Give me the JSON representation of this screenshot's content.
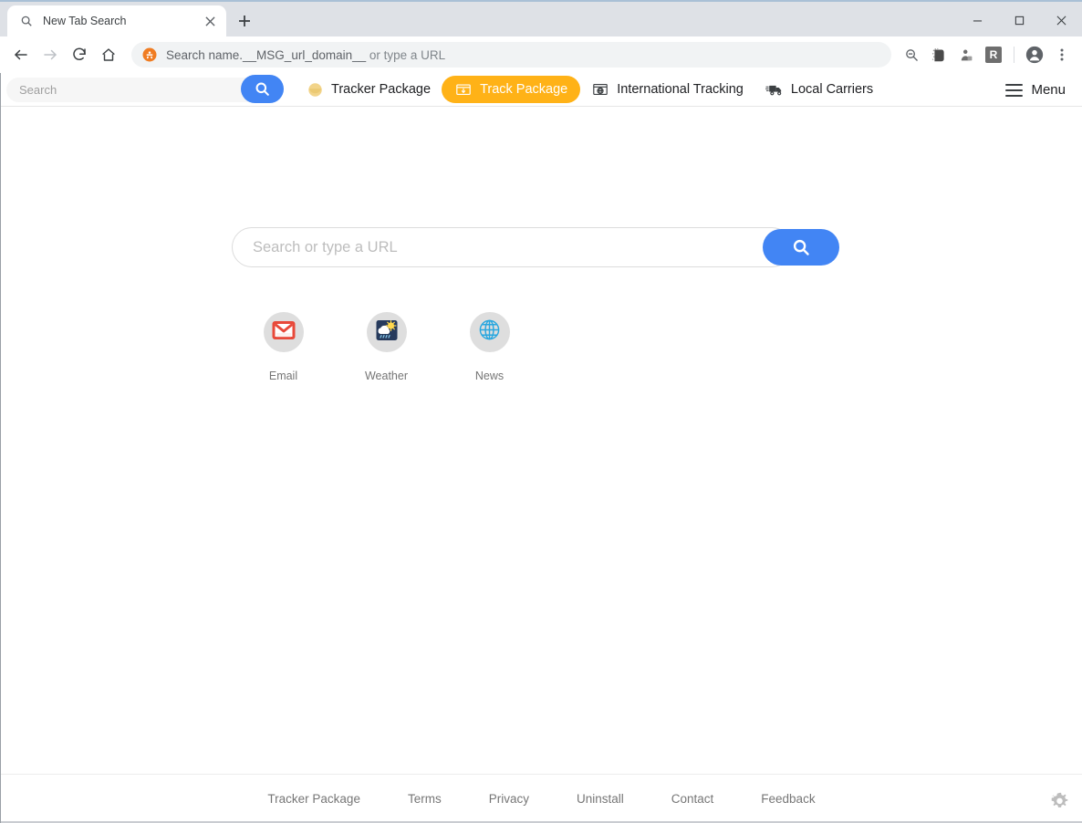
{
  "browser": {
    "tab": {
      "title": "New Tab Search",
      "favicon_name": "search-icon",
      "close_label": "×"
    },
    "new_tab_button_label": "+",
    "window_controls": {
      "minimize": "—",
      "maximize": "□",
      "close": "✕"
    },
    "nav": {
      "back_label": "←",
      "forward_label": "→",
      "reload_label": "↻",
      "home_label": "⌂"
    },
    "omnibox": {
      "text": "Search name.__MSG_url_domain__ or type a URL",
      "query_part": "Search name.__MSG_url_domain__",
      "hint_part": " or type a URL",
      "favicon_name": "extension-favicon-orange"
    },
    "toolbar_icons": [
      {
        "name": "zoom-out-icon",
        "glyph": "zoom"
      },
      {
        "name": "extension-icon-dark",
        "glyph": "ext"
      },
      {
        "name": "extension-icon-small",
        "glyph": "ext2"
      },
      {
        "name": "extension-badge-r",
        "label": "R"
      }
    ],
    "profile_name": "profile-avatar",
    "menu_name": "browser-menu-icon"
  },
  "ext_nav": {
    "search": {
      "value": "",
      "placeholder": "Search",
      "button_name": "nav-search-button",
      "button_color": "#4285f4"
    },
    "items": [
      {
        "label": "Tracker Package",
        "icon": "package-circle-icon",
        "active": false
      },
      {
        "label": "Track Package",
        "icon": "package-box-icon",
        "active": true
      },
      {
        "label": "International Tracking",
        "icon": "international-package-icon",
        "active": false
      },
      {
        "label": "Local Carriers",
        "icon": "delivery-truck-icon",
        "active": false
      }
    ],
    "active_pill_color": "#ffb217",
    "menu": {
      "label": "Menu",
      "icon": "hamburger-menu-icon"
    }
  },
  "hero": {
    "search": {
      "value": "",
      "placeholder": "Search or type a URL",
      "button_name": "hero-search-button",
      "button_color": "#4285f4"
    }
  },
  "shortcuts": [
    {
      "label": "Email",
      "icon": "gmail-envelope-icon",
      "color": "#e8493a"
    },
    {
      "label": "Weather",
      "icon": "weather-cloud-sun-icon",
      "color": "#263a5c"
    },
    {
      "label": "News",
      "icon": "globe-icon",
      "color": "#29a7df"
    }
  ],
  "footer": {
    "links": [
      "Tracker Package",
      "Terms",
      "Privacy",
      "Uninstall",
      "Contact",
      "Feedback"
    ],
    "settings_icon": "gear-icon"
  }
}
